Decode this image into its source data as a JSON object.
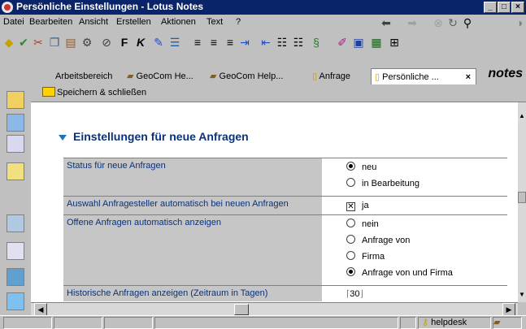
{
  "window": {
    "title": "Persönliche Einstellungen - Lotus Notes",
    "minimize_glyph": "_",
    "maximize_glyph": "□",
    "close_glyph": "×"
  },
  "menu": [
    {
      "label": "Datei"
    },
    {
      "label": "Bearbeiten"
    },
    {
      "label": "Ansicht"
    },
    {
      "label": "Erstellen"
    },
    {
      "label": "Aktionen"
    },
    {
      "label": "Text"
    },
    {
      "label": "?"
    }
  ],
  "tabs": [
    {
      "label": "Arbeitsbereich"
    },
    {
      "label": "GeoCom He..."
    },
    {
      "label": "GeoCom Help..."
    },
    {
      "label": "Anfrage"
    },
    {
      "label": "Persönliche ..."
    }
  ],
  "tab_close_glyph": "×",
  "brand": "notes",
  "action_bar": {
    "save_label": "Speichern & schließen"
  },
  "section": {
    "title": "Einstellungen für neue Anfragen"
  },
  "rows": [
    {
      "label": "Status für neue Anfragen",
      "options": [
        {
          "label": "neu",
          "selected": true
        },
        {
          "label": "in Bearbeitung",
          "selected": false
        }
      ]
    },
    {
      "label": "Auswahl Anfragesteller automatisch bei neuen Anfragen",
      "checkbox": {
        "label": "ja",
        "checked": true,
        "mark": "✕"
      }
    },
    {
      "label": "Offene Anfragen automatisch anzeigen",
      "options": [
        {
          "label": "nein",
          "selected": false
        },
        {
          "label": "Anfrage von",
          "selected": false
        },
        {
          "label": "Firma",
          "selected": false
        },
        {
          "label": "Anfrage von und Firma",
          "selected": true
        }
      ]
    },
    {
      "label": "Historische Anfragen anzeigen (Zeitraum in Tagen)",
      "value": "30"
    }
  ],
  "status": {
    "user": "helpdesk"
  },
  "colors": {
    "title_bar": "#0a246a",
    "label_text": "#0a3278",
    "section_arrow": "#1c74b8"
  }
}
